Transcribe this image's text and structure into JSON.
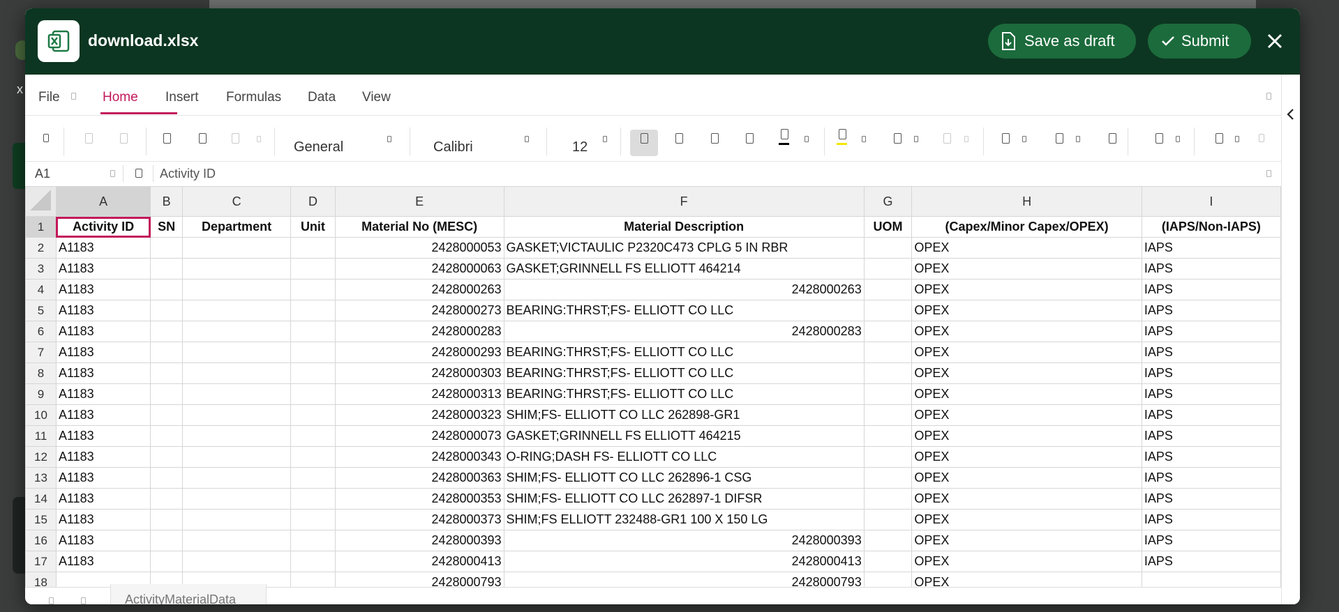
{
  "file": {
    "name": "download.xlsx"
  },
  "header": {
    "save_draft_label": "Save as draft",
    "submit_label": "Submit"
  },
  "ribbon": {
    "tabs": [
      "File",
      "Home",
      "Insert",
      "Formulas",
      "Data",
      "View"
    ],
    "active_tab": "Home"
  },
  "toolbar": {
    "number_format": "General",
    "font_name": "Calibri",
    "font_size": "12"
  },
  "formula_bar": {
    "cell_ref": "A1",
    "value": "Activity ID"
  },
  "sheet": {
    "columns": [
      "A",
      "B",
      "C",
      "D",
      "E",
      "F",
      "G",
      "H",
      "I"
    ],
    "header_row": [
      "Activity ID",
      "SN",
      "Department",
      "Unit",
      "Material No (MESC)",
      "Material Description",
      "UOM",
      "(Capex/Minor Capex/OPEX)",
      "(IAPS/Non-IAPS)"
    ],
    "rows": [
      [
        "A1183",
        "",
        "",
        "",
        "2428000053",
        "GASKET;VICTAULIC P2320C473 CPLG 5 IN RBR",
        "",
        "OPEX",
        "IAPS"
      ],
      [
        "A1183",
        "",
        "",
        "",
        "2428000063",
        "GASKET;GRINNELL FS ELLIOTT 464214",
        "",
        "OPEX",
        "IAPS"
      ],
      [
        "A1183",
        "",
        "",
        "",
        "2428000263",
        "2428000263",
        "",
        "OPEX",
        "IAPS"
      ],
      [
        "A1183",
        "",
        "",
        "",
        "2428000273",
        "BEARING:THRST;FS- ELLIOTT CO LLC",
        "",
        "OPEX",
        "IAPS"
      ],
      [
        "A1183",
        "",
        "",
        "",
        "2428000283",
        "2428000283",
        "",
        "OPEX",
        "IAPS"
      ],
      [
        "A1183",
        "",
        "",
        "",
        "2428000293",
        "BEARING:THRST;FS- ELLIOTT CO LLC",
        "",
        "OPEX",
        "IAPS"
      ],
      [
        "A1183",
        "",
        "",
        "",
        "2428000303",
        "BEARING:THRST;FS- ELLIOTT CO LLC",
        "",
        "OPEX",
        "IAPS"
      ],
      [
        "A1183",
        "",
        "",
        "",
        "2428000313",
        "BEARING:THRST;FS- ELLIOTT CO LLC",
        "",
        "OPEX",
        "IAPS"
      ],
      [
        "A1183",
        "",
        "",
        "",
        "2428000323",
        "SHIM;FS- ELLIOTT CO LLC 262898-GR1",
        "",
        "OPEX",
        "IAPS"
      ],
      [
        "A1183",
        "",
        "",
        "",
        "2428000073",
        "GASKET;GRINNELL FS ELLIOTT 464215",
        "",
        "OPEX",
        "IAPS"
      ],
      [
        "A1183",
        "",
        "",
        "",
        "2428000343",
        "O-RING;DASH FS- ELLIOTT CO LLC",
        "",
        "OPEX",
        "IAPS"
      ],
      [
        "A1183",
        "",
        "",
        "",
        "2428000363",
        "SHIM;FS- ELLIOTT CO LLC 262896-1 CSG",
        "",
        "OPEX",
        "IAPS"
      ],
      [
        "A1183",
        "",
        "",
        "",
        "2428000353",
        "SHIM;FS- ELLIOTT CO LLC 262897-1 DIFSR",
        "",
        "OPEX",
        "IAPS"
      ],
      [
        "A1183",
        "",
        "",
        "",
        "2428000373",
        "SHIM;FS ELLIOTT 232488-GR1 100 X 150 LG",
        "",
        "OPEX",
        "IAPS"
      ],
      [
        "A1183",
        "",
        "",
        "",
        "2428000393",
        "2428000393",
        "",
        "OPEX",
        "IAPS"
      ],
      [
        "A1183",
        "",
        "",
        "",
        "2428000413",
        "2428000413",
        "",
        "OPEX",
        "IAPS"
      ],
      [
        "",
        "",
        "",
        "",
        "2428000793",
        "2428000793",
        "",
        "OPEX",
        ""
      ]
    ],
    "sheet_tab": "ActivityMaterialData"
  },
  "colors": {
    "header_bg": "#0c3621",
    "button_bg": "#1c6b3c",
    "accent": "#c2185b"
  }
}
